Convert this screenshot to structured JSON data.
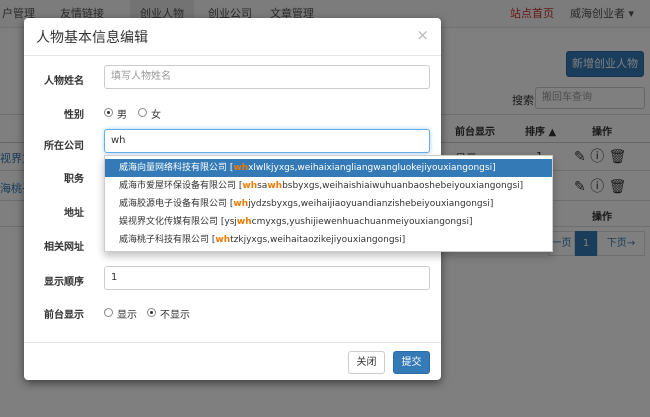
{
  "nav": {
    "items": [
      "户管理",
      "友情链接",
      "创业人物",
      "创业公司",
      "文章管理"
    ],
    "home_link": "站点首页",
    "user_menu": "威海创业者 ▾"
  },
  "background": {
    "add_button": "新增创业人物",
    "search_label": "搜索:",
    "search_placeholder": "搬回车查询",
    "table_headers": [
      "前台显示",
      "排序 ▲",
      "操作"
    ],
    "rows": [
      {
        "name_snippet": "视界文",
        "display": "显示",
        "order": "1"
      },
      {
        "name_snippet": "海桃子",
        "display": "",
        "order": ""
      }
    ],
    "footer_header": "操作",
    "pager_prev": "一页",
    "pager_current": "1",
    "pager_next": "下页→"
  },
  "modal": {
    "title": "人物基本信息编辑",
    "close": "×",
    "fields": {
      "name_label": "人物姓名",
      "name_placeholder": "填写人物姓名",
      "gender_label": "性别",
      "gender_male": "男",
      "gender_female": "女",
      "company_label": "所在公司",
      "company_value": "wh",
      "position_label": "职务",
      "address_label": "地址",
      "url_label": "相关网址",
      "order_label": "显示顺序",
      "order_value": "1",
      "display_label": "前台显示",
      "display_show": "显示",
      "display_hide": "不显示"
    },
    "buttons": {
      "close": "关闭",
      "submit": "提交"
    }
  },
  "autocomplete": [
    {
      "pre": "威海向量网络科技有限公司 [",
      "hl": "wh",
      "post": "xlwlkjyxgs,weihaixiangliangwangluokejiyouxiangongsi]",
      "hl2": "",
      "post2": ""
    },
    {
      "pre": "威海市爱屋环保设备有限公司 [",
      "hl": "wh",
      "post": "sa",
      "hl2": "wh",
      "post2": "bsbyxgs,weihaishiaiwuhuanbaoshebeiyouxiangongsi]"
    },
    {
      "pre": "威海胶源电子设备有限公司 [",
      "hl": "wh",
      "post": "jydzsbyxgs,weihaijiaoyuandianzishebeiyouxiangongsi]",
      "hl2": "",
      "post2": ""
    },
    {
      "pre": "娱视界文化传媒有限公司 [ysj",
      "hl": "wh",
      "post": "cmyxgs,yushijiewenhuachuanmeiyouxiangongsi]",
      "hl2": "",
      "post2": ""
    },
    {
      "pre": "威海桃子科技有限公司 [",
      "hl": "wh",
      "post": "tzkjyxgs,weihaitaozikejiyouxiangongsi]",
      "hl2": "",
      "post2": ""
    }
  ],
  "colors": {
    "primary": "#337ab7",
    "highlight": "#ee7a00",
    "nav_red": "#c9302c"
  }
}
